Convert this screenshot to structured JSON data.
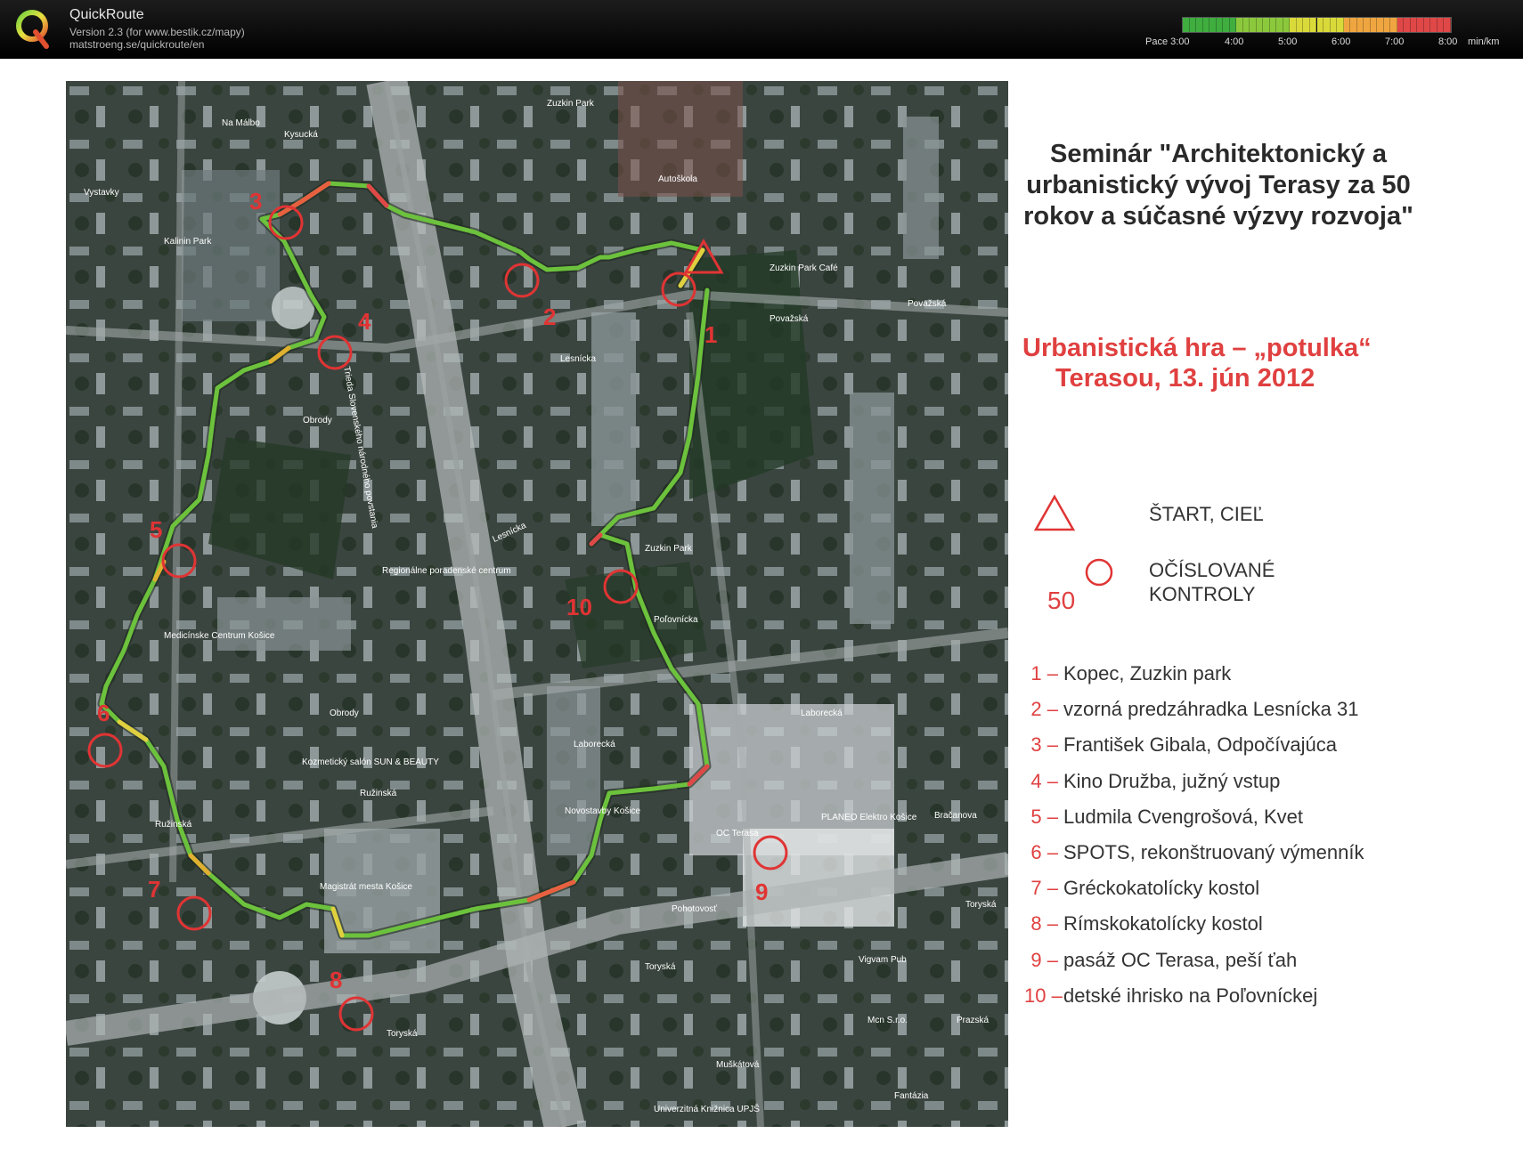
{
  "app": {
    "title": "QuickRoute",
    "version": "Version 2.3  (for www.bestik.cz/mapy)",
    "url": "matstroeng.se/quickroute/en"
  },
  "pace_scale": {
    "label": "Pace 3:00",
    "ticks": [
      "4:00",
      "5:00",
      "6:00",
      "7:00",
      "8:00"
    ],
    "unit": "min/km",
    "colors": [
      "#3fae3f",
      "#8cc83c",
      "#d9d93a",
      "#f0a640",
      "#e04848"
    ]
  },
  "map": {
    "title": "Seminár \"Architektonický a urbanistický vývoj Terasy za 50 rokov a súčasné výzvy rozvoja\"",
    "game_title": "Urbanistická hra – „potulka“",
    "game_date": "Terasou, 13. jún 2012",
    "legend": {
      "start_finish": "ŠTART, CIEĽ",
      "control_sample_number": "50",
      "numbered_controls_line1": "OČÍSLOVANÉ",
      "numbered_controls_line2": "KONTROLY"
    },
    "controls": [
      {
        "num": "1 –",
        "desc": "Kopec, Zuzkin park"
      },
      {
        "num": "2 –",
        "desc": "vzorná predzáhradka Lesnícka 31"
      },
      {
        "num": "3 –",
        "desc": "František Gibala, Odpočívajúca"
      },
      {
        "num": "4 –",
        "desc": "Kino Družba, južný vstup"
      },
      {
        "num": "5 –",
        "desc": "Ludmila Cvengrošová, Kvet"
      },
      {
        "num": "6 –",
        "desc": "SPOTS, rekonštruovaný výmenník"
      },
      {
        "num": "7 –",
        "desc": "Gréckokatolícky kostol"
      },
      {
        "num": "8 –",
        "desc": "Rímskokatolícky kostol"
      },
      {
        "num": "9 –",
        "desc": "pasáž OC Terasa, peší ťah"
      },
      {
        "num": "10 –",
        "desc": "detské ihrisko na Poľovníckej"
      }
    ],
    "map_control_numbers": [
      "1",
      "2",
      "3",
      "4",
      "5",
      "6",
      "7",
      "8",
      "9",
      "10"
    ],
    "street_labels": [
      "Kysucká",
      "Považská",
      "Považská",
      "Lesnícka",
      "Lesnícka",
      "Obrody",
      "Obrody",
      "Ružinská",
      "Ružinská",
      "Laborecká",
      "Laborecká",
      "Toryská",
      "Toryská",
      "Toryská",
      "Muškátová",
      "Poľovnícka",
      "Zuzkin Park",
      "Zuzkin Park",
      "Trieda Slovenského národného povstania",
      "Bračanova",
      "Vystavky",
      "Kalinin Park",
      "Na Málbo",
      "Autoškola",
      "Magistrát mesta Košice",
      "Novostavby Košice",
      "PLANEO Elektro Košice",
      "Vigvam Pub",
      "Univerzitná Knižnica UPJŠ",
      "Medicínske Centrum Košice",
      "Kozmetický salón SUN & BEAUTY",
      "Regionálne poradenské centrum",
      "Pohotovosť",
      "Mcn S.r.o.",
      "OC Terasa",
      "Fantázia",
      "Prazská",
      "Zuzkin Park Café"
    ],
    "colors": {
      "control_red": "#e03434",
      "title_red": "#e04040",
      "route_green": "#4caf3a",
      "route_yellow": "#d8d83a",
      "route_red": "#e04848"
    }
  }
}
